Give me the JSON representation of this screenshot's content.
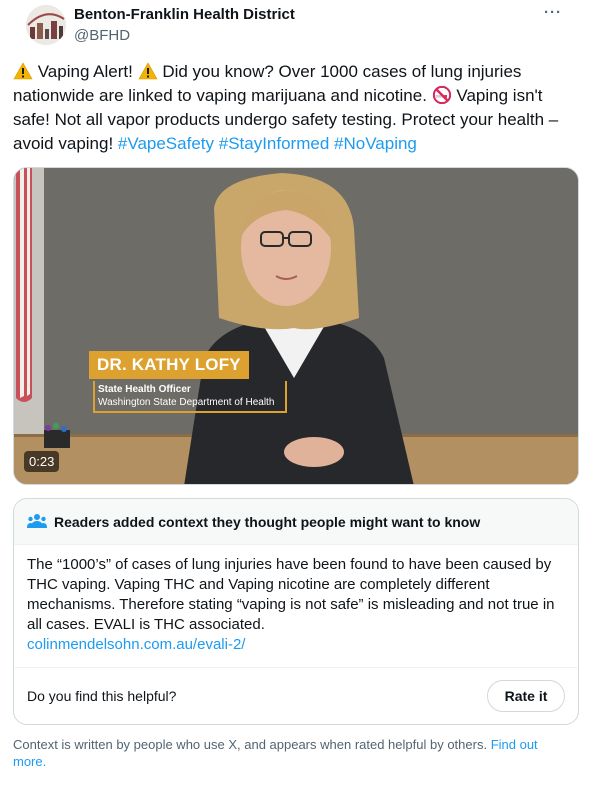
{
  "author": {
    "name": "Benton-Franklin Health District",
    "handle": "@BFHD"
  },
  "tweet": {
    "part1": " Vaping Alert! ",
    "part2": " Did you know? Over 1000 cases of lung injuries nationwide are linked to vaping marijuana and nicotine. ",
    "part3": " Vaping isn't safe! Not all vapor products undergo safety testing. Protect your health – avoid vaping! ",
    "hashtags": [
      "#VapeSafety",
      "#StayInformed",
      "#NoVaping"
    ],
    "emojis": [
      "warning-icon",
      "no-smoking-icon"
    ]
  },
  "video": {
    "lower_third_name": "DR. KATHY LOFY",
    "lower_third_title": "State Health Officer",
    "lower_third_org": "Washington State Department of Health",
    "timecode": "0:23"
  },
  "community_note": {
    "header": "Readers added context they thought people might want to know",
    "body": "The “1000’s” of cases of lung injuries have been found to have been caused by THC vaping. Vaping THC and Vaping nicotine are completely different mechanisms. Therefore stating “vaping is not safe” is misleading and not true in all cases. EVALI is THC associated.",
    "link": "colinmendelsohn.com.au/evali-2/",
    "question": "Do you find this helpful?",
    "rate_label": "Rate it"
  },
  "footer": {
    "text": "Context is written by people who use X, and appears when rated helpful by others. ",
    "link": "Find out more."
  },
  "colors": {
    "accent": "#1d9bf0",
    "lower_third": "#dca12f",
    "text": "#0f1419",
    "muted": "#536471"
  }
}
